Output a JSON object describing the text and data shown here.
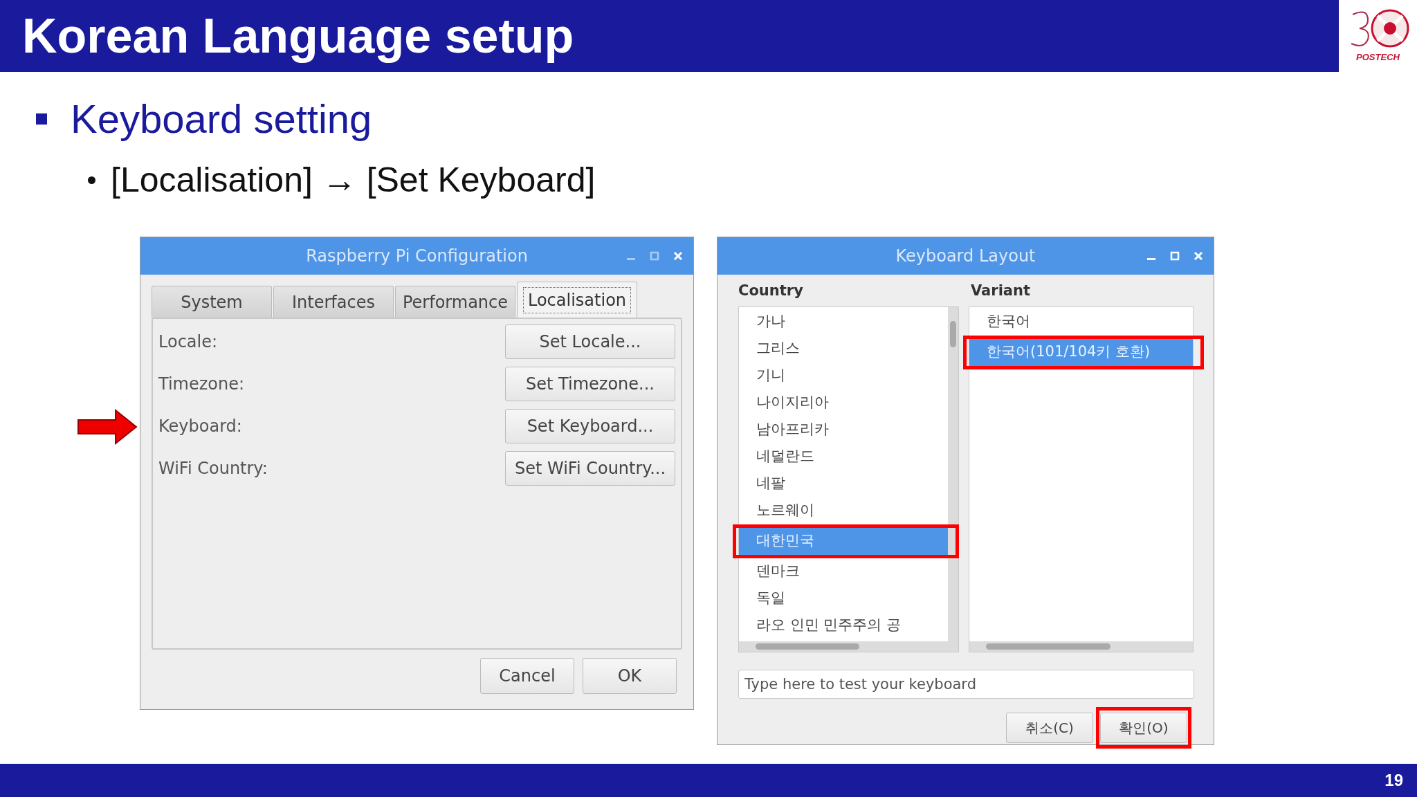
{
  "slide": {
    "title": "Korean Language setup",
    "logo_text": "POSTECH",
    "page_number": "19"
  },
  "bullets": [
    {
      "text": "Keyboard setting",
      "children": [
        {
          "text": "[Localisation] → [Set Keyboard]"
        }
      ]
    }
  ],
  "config_window": {
    "title": "Raspberry Pi Configuration",
    "tabs": [
      {
        "label": "System",
        "selected": false
      },
      {
        "label": "Interfaces",
        "selected": false
      },
      {
        "label": "Performance",
        "selected": false
      },
      {
        "label": "Localisation",
        "selected": true
      }
    ],
    "rows": [
      {
        "label": "Locale:",
        "button": "Set Locale...",
        "pointed": false
      },
      {
        "label": "Timezone:",
        "button": "Set Timezone...",
        "pointed": false
      },
      {
        "label": "Keyboard:",
        "button": "Set Keyboard...",
        "pointed": true
      },
      {
        "label": "WiFi Country:",
        "button": "Set WiFi Country...",
        "pointed": false
      }
    ],
    "buttons": [
      "Cancel",
      "OK"
    ]
  },
  "keyboard_window": {
    "title": "Keyboard Layout",
    "country_header": "Country",
    "variant_header": "Variant",
    "countries": [
      {
        "label": "가나",
        "selected": false,
        "highlighted": false
      },
      {
        "label": "그리스",
        "selected": false,
        "highlighted": false
      },
      {
        "label": "기니",
        "selected": false,
        "highlighted": false
      },
      {
        "label": "나이지리아",
        "selected": false,
        "highlighted": false
      },
      {
        "label": "남아프리카",
        "selected": false,
        "highlighted": false
      },
      {
        "label": "네덜란드",
        "selected": false,
        "highlighted": false
      },
      {
        "label": "네팔",
        "selected": false,
        "highlighted": false
      },
      {
        "label": "노르웨이",
        "selected": false,
        "highlighted": false
      },
      {
        "label": "대한민국",
        "selected": true,
        "highlighted": true
      },
      {
        "label": "덴마크",
        "selected": false,
        "highlighted": false
      },
      {
        "label": "독일",
        "selected": false,
        "highlighted": false
      },
      {
        "label": "라오 인민 민주주의 공",
        "selected": false,
        "highlighted": false
      }
    ],
    "variants": [
      {
        "label": "한국어",
        "selected": false,
        "highlighted": false
      },
      {
        "label": "한국어(101/104키 호환)",
        "selected": true,
        "highlighted": true
      }
    ],
    "test_field": {
      "placeholder": "Type here to test your keyboard"
    },
    "buttons": [
      {
        "label": "취소(C)",
        "highlighted": false
      },
      {
        "label": "확인(O)",
        "highlighted": true
      }
    ]
  }
}
